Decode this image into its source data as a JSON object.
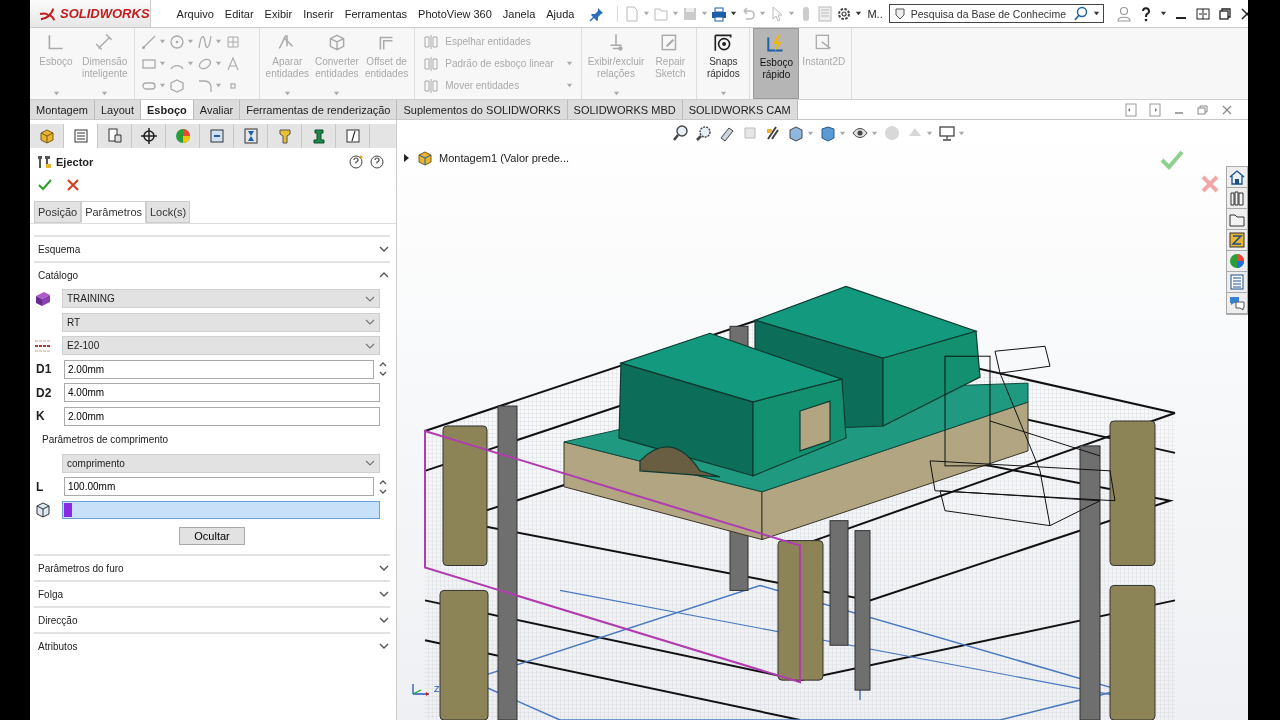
{
  "logo": "SOLIDWORKS",
  "menu": [
    "Arquivo",
    "Editar",
    "Exibir",
    "Inserir",
    "Ferramentas",
    "PhotoView 360",
    "Janela",
    "Ajuda"
  ],
  "toolbar_overflow": "M..",
  "search": {
    "placeholder": "Pesquisa da Base de Conhecime"
  },
  "ribbon": [
    {
      "kind": "buttons",
      "items": [
        {
          "label": "Esboço",
          "disabled": true,
          "on": false,
          "dropdown": true
        },
        {
          "label": "Dimensão\ninteligente",
          "disabled": true,
          "on": false,
          "dropdown": true
        }
      ]
    },
    {
      "kind": "tools"
    },
    {
      "kind": "buttons",
      "items": [
        {
          "label": "Aparar\nentidades",
          "disabled": true,
          "on": false,
          "dropdown": true
        },
        {
          "label": "Converter\nentidades",
          "disabled": true,
          "on": false,
          "dropdown": true
        },
        {
          "label": "Offset de\nentidades",
          "disabled": true,
          "on": false,
          "dropdown": false
        }
      ]
    },
    {
      "kind": "stack",
      "items": [
        {
          "label": "Espelhar entidades",
          "disabled": true,
          "dropdown": false
        },
        {
          "label": "Padrão de esboço linear",
          "disabled": true,
          "dropdown": true
        },
        {
          "label": "Mover entidades",
          "disabled": true,
          "dropdown": true
        }
      ]
    },
    {
      "kind": "buttons",
      "items": [
        {
          "label": "Exibir/excluir\nrelações",
          "disabled": true,
          "on": false,
          "dropdown": true
        },
        {
          "label": "Repair\nSketch",
          "disabled": true,
          "on": false,
          "dropdown": false
        }
      ]
    },
    {
      "kind": "buttons",
      "items": [
        {
          "label": "Snaps\nrápidos",
          "disabled": false,
          "on": false,
          "dropdown": true
        }
      ]
    },
    {
      "kind": "buttons",
      "items": [
        {
          "label": "Esboço\nrápido",
          "disabled": false,
          "on": true,
          "dropdown": false
        },
        {
          "label": "Instant2D",
          "disabled": true,
          "on": false,
          "dropdown": false
        }
      ]
    }
  ],
  "command_tabs": [
    {
      "label": "Montagem",
      "selected": false
    },
    {
      "label": "Layout",
      "selected": false
    },
    {
      "label": "Esboço",
      "selected": true
    },
    {
      "label": "Avaliar",
      "selected": false
    },
    {
      "label": "Ferramentas de renderização",
      "selected": false
    },
    {
      "label": "Suplementos do SOLIDWORKS",
      "selected": false
    },
    {
      "label": "SOLIDWORKS MBD",
      "selected": false
    },
    {
      "label": "SOLIDWORKS CAM",
      "selected": false
    }
  ],
  "property_manager": {
    "title": "Ejector",
    "tabs": [
      {
        "label": "Posição",
        "selected": false
      },
      {
        "label": "Parâmetros",
        "selected": true
      },
      {
        "label": "Lock(s)",
        "selected": false
      }
    ],
    "sections": [
      {
        "title": "Esquema",
        "expanded": false
      },
      {
        "title": "Catálogo",
        "expanded": true,
        "rows": [
          {
            "kind": "library",
            "value": "TRAINING"
          },
          {
            "kind": "select",
            "value": "RT"
          },
          {
            "kind": "size",
            "value": "E2-100"
          },
          {
            "kind": "dimension",
            "label": "D1",
            "value": "2.00mm",
            "spinner": true
          },
          {
            "kind": "dimension",
            "label": "D2",
            "value": "4.00mm",
            "spinner": false
          },
          {
            "kind": "dimension",
            "label": "K",
            "value": "2.00mm",
            "spinner": false
          },
          {
            "kind": "caption",
            "label": "Parâmetros de comprimento"
          },
          {
            "kind": "select",
            "value": "comprimento"
          },
          {
            "kind": "dimension",
            "label": "L",
            "value": "100.00mm",
            "spinner": true
          },
          {
            "kind": "selection",
            "active": true
          },
          {
            "kind": "button",
            "label": "Ocultar"
          }
        ]
      },
      {
        "title": "Parâmetros do furo",
        "expanded": false
      },
      {
        "title": "Folga",
        "expanded": false
      },
      {
        "title": "Direcção",
        "expanded": false
      },
      {
        "title": "Atributos",
        "expanded": false
      }
    ]
  },
  "feature_tree": {
    "label": "Montagem1 (Valor prede...",
    "expanded": false
  },
  "triad_label": "Z"
}
